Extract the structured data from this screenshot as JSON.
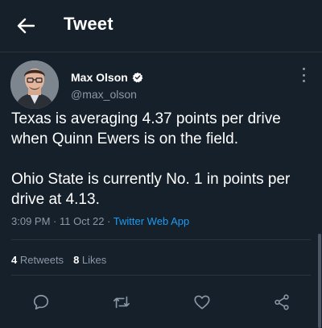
{
  "header": {
    "title": "Tweet",
    "back_icon": "arrow-left-icon"
  },
  "author": {
    "name": "Max Olson",
    "handle": "@max_olson",
    "verified": true
  },
  "tweet": {
    "text": "Texas is averaging 4.37 points per drive\nwhen Quinn Ewers is on the field.\n\nOhio State is currently No. 1 in points per\ndrive at 4.13.",
    "time": "3:09 PM",
    "date": "11 Oct 22",
    "separator": "·",
    "source": "Twitter Web App"
  },
  "stats": {
    "retweets_count": "4",
    "retweets_label": "Retweets",
    "likes_count": "8",
    "likes_label": "Likes"
  },
  "actions": [
    "reply-icon",
    "retweet-icon",
    "like-icon",
    "share-icon"
  ],
  "colors": {
    "background": "#15202b",
    "accent": "#1d9bf0",
    "muted": "#8b98a5",
    "divider": "#2f3336",
    "verified": "#ffffff"
  }
}
